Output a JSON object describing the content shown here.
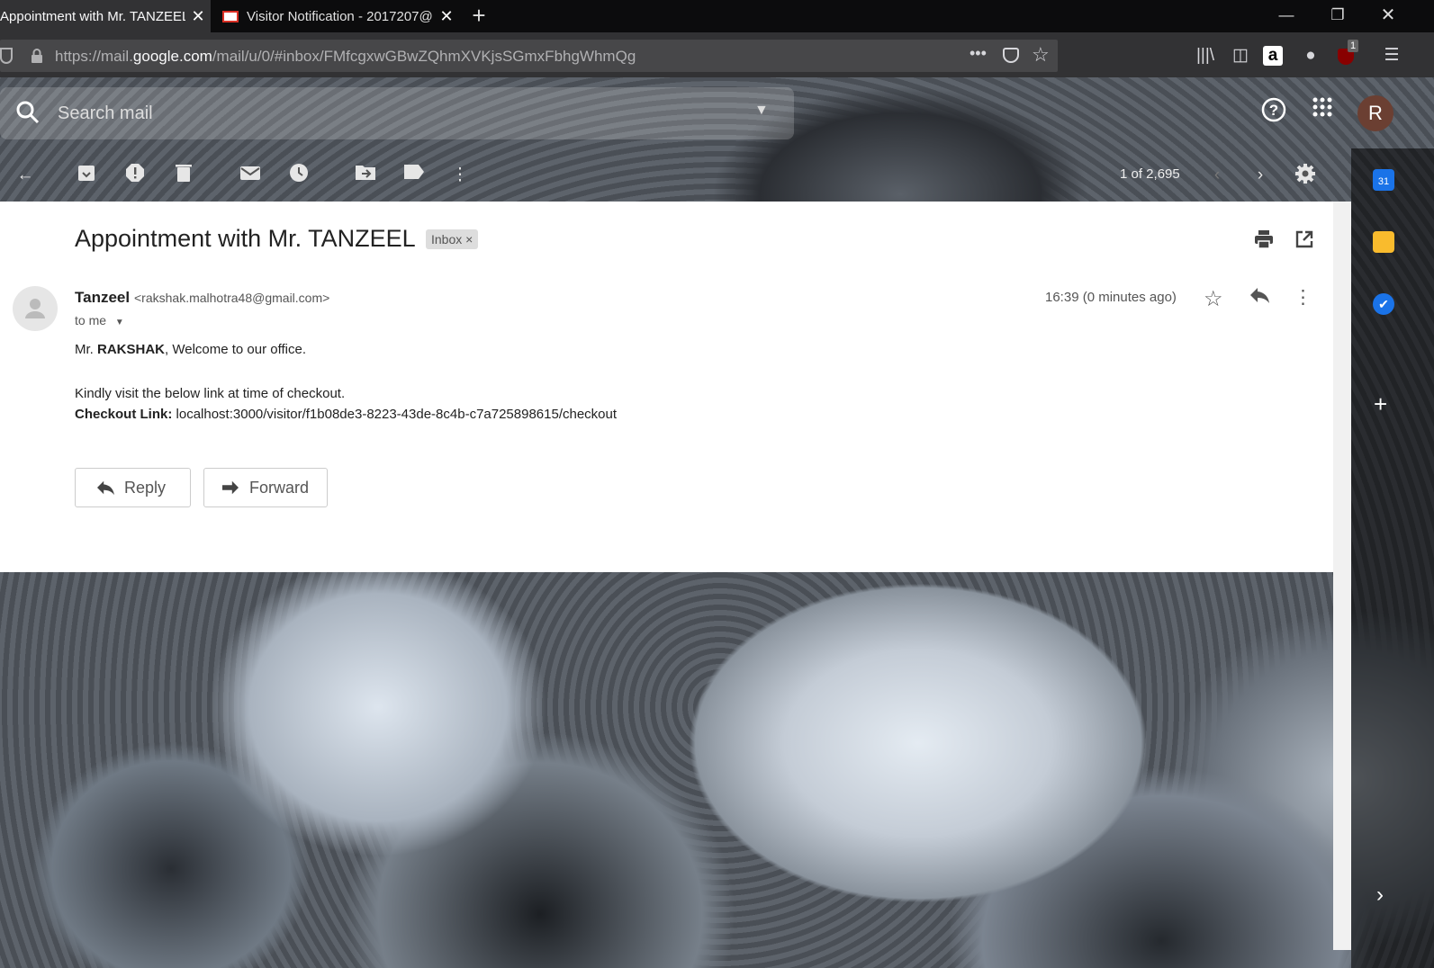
{
  "browser": {
    "tabs": [
      {
        "title": "Appointment with Mr. TANZEEL",
        "active": true
      },
      {
        "title": "Visitor Notification - 2017207@",
        "active": false
      }
    ],
    "new_tab_symbol": "+",
    "url_prefix": "https://mail.",
    "url_domain": "google.com",
    "url_path": "/mail/u/0/#inbox/FMfcgxwGBwZQhmXVKjsSGmxFbhgWhmQg",
    "page_actions": "•••",
    "extension_badge": "1"
  },
  "gmail": {
    "search": {
      "placeholder": "Search mail"
    },
    "avatar_letter": "R",
    "pager": "1 of 2,695",
    "calendar_day": "31"
  },
  "message": {
    "subject": "Appointment with Mr. TANZEEL",
    "label_chip": "Inbox",
    "label_remove": "×",
    "sender_name": "Tanzeel",
    "sender_email": "<rakshak.malhotra48@gmail.com>",
    "to_line": "to me",
    "datetime": "16:39 (0 minutes ago)",
    "greeting_prefix": "Mr. ",
    "greeting_name": "RAKSHAK",
    "greeting_suffix": ", Welcome to our office.",
    "instruction": "Kindly visit the below link at time of checkout.",
    "checkout_label": "Checkout Link:",
    "checkout_url": "localhost:3000/visitor/f1b08de3-8223-43de-8c4b-c7a725898615/checkout"
  },
  "actions": {
    "reply": "Reply",
    "forward": "Forward"
  },
  "colors": {
    "avatar": "#6b3f32",
    "calendar": "#1a73e8",
    "keep": "#f9bb2d",
    "tasks": "#1a73e8"
  }
}
